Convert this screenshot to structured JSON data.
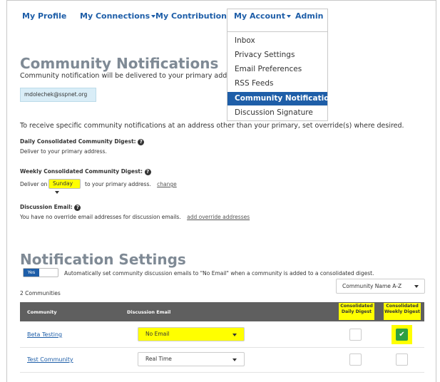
{
  "nav": {
    "profile": "My Profile",
    "connections": "My Connections",
    "contributions": "My Contributions",
    "account": "My Account",
    "admin": "Admin"
  },
  "account_menu": {
    "items": [
      "Inbox",
      "Privacy Settings",
      "Email Preferences",
      "RSS Feeds",
      "Community Notifications",
      "Discussion Signature"
    ],
    "active": "Community Notifications"
  },
  "community_notifications": {
    "title": "Community Notifications",
    "description": "Community notification will be delivered to your primary addre",
    "email": "mdolechek@sspnet.org",
    "override_text": "To receive specific community notifications at an address other than your primary, set override(s) where desired.",
    "daily_label": "Daily Consolidated Community Digest:",
    "daily_text": "Deliver to your primary address.",
    "weekly_label": "Weekly Consolidated Community Digest:",
    "weekly_prefix": "Deliver on",
    "weekly_day": "Sunday",
    "weekly_suffix": "to your primary address.",
    "weekly_change": "change",
    "discussion_label": "Discussion Email:",
    "discussion_text": "You have no override email addresses for discussion emails.",
    "discussion_link": "add override addresses"
  },
  "notification_settings": {
    "title": "Notification Settings",
    "toggle_value": "Yes",
    "toggle_text": "Automatically set community discussion emails to \"No Email\" when a community is added to a consolidated digest.",
    "count": "2 Communities",
    "sort_value": "Community Name A-Z",
    "columns": {
      "community": "Community",
      "discussion": "Discussion Email",
      "daily_1": "Consolidated",
      "daily_2": "Daily Digest",
      "weekly_1": "Consolidated",
      "weekly_2": "Weekly Digest"
    },
    "rows": [
      {
        "name": "Beta Testing",
        "discussion": "No Email",
        "daily": false,
        "weekly": true
      },
      {
        "name": "Test Community",
        "discussion": "Real Time",
        "daily": false,
        "weekly": false
      }
    ]
  },
  "colors": {
    "accent": "#1e5ea8",
    "highlight": "#ffff00",
    "heading": "#7f8a95",
    "check": "#2ea042"
  },
  "icons": {
    "help": "question-circle-icon",
    "check": "checkmark-icon",
    "caret": "chevron-down-icon"
  }
}
